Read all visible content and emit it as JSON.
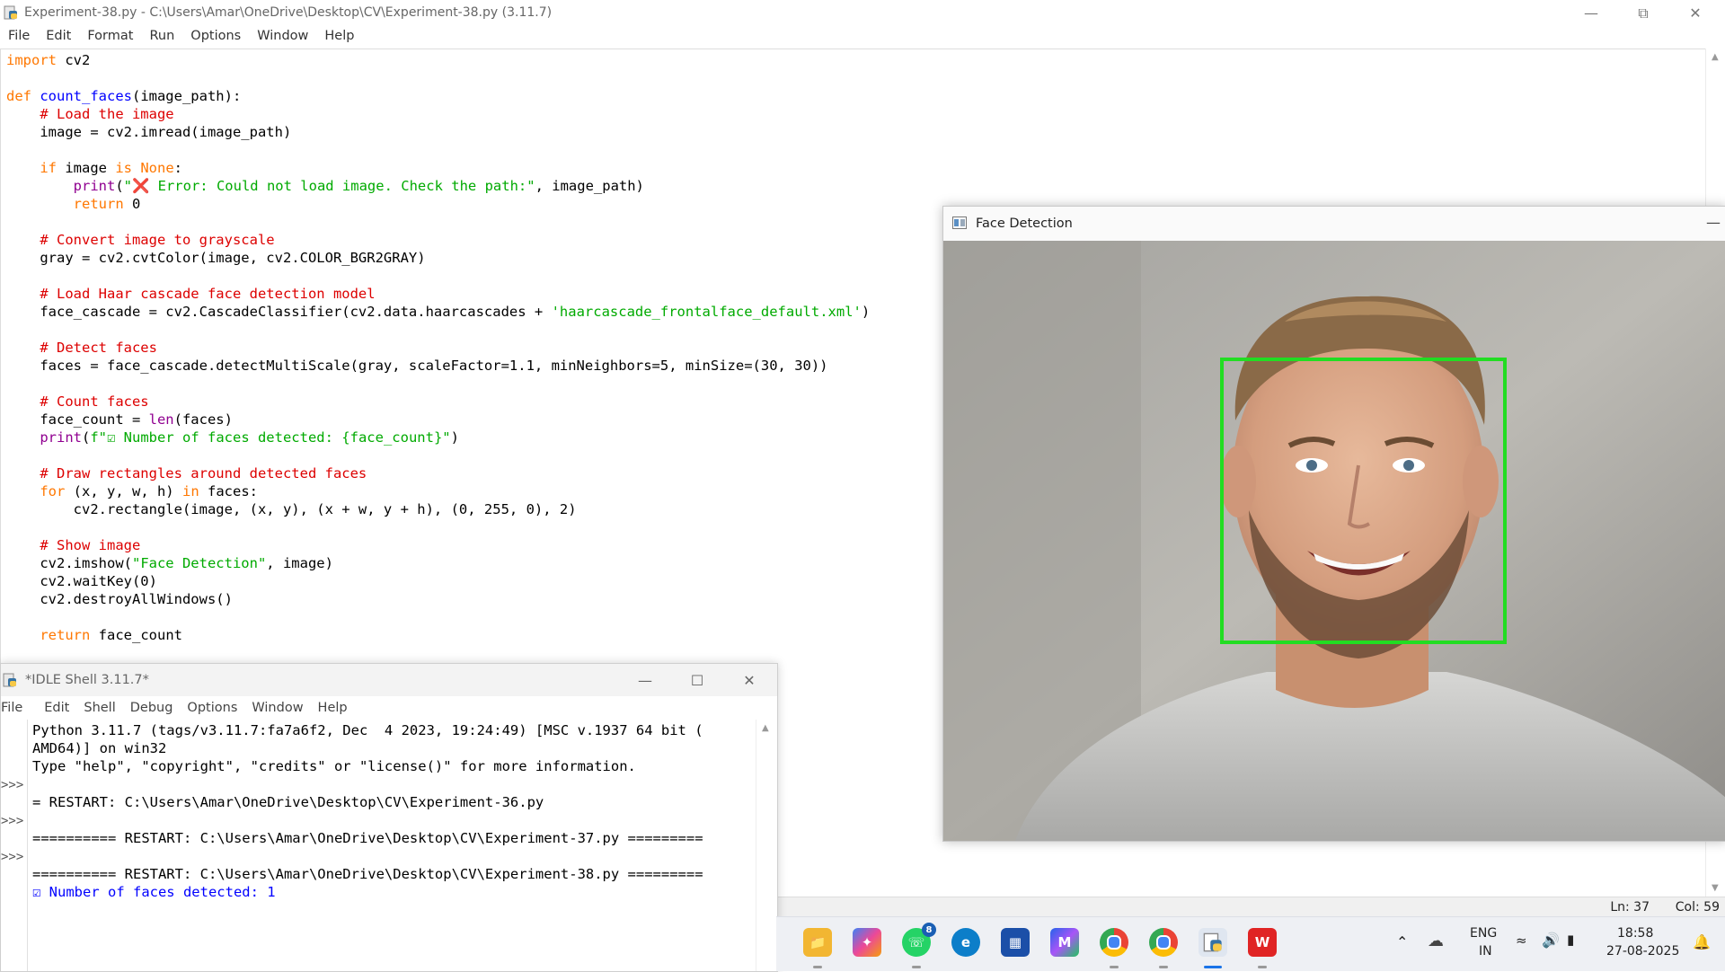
{
  "editor": {
    "title": "Experiment-38.py - C:\\Users\\Amar\\OneDrive\\Desktop\\CV\\Experiment-38.py (3.11.7)",
    "menu": [
      "File",
      "Edit",
      "Format",
      "Run",
      "Options",
      "Window",
      "Help"
    ],
    "status_ln": "Ln: 37",
    "status_col": "Col: 59",
    "code": {
      "l1_kw": "import",
      "l1_rest": " cv2",
      "l3_kw": "def",
      "l3_fn": " count_faces",
      "l3_rest": "(image_path):",
      "l4_cm": "    # Load the image",
      "l5": "    image = cv2.imread(image_path)",
      "l7_kw1": "    if",
      "l7_mid": " image ",
      "l7_kw2": "is",
      "l7_sp": " ",
      "l7_kw3": "None",
      "l7_end": ":",
      "l8_ind": "        ",
      "l8_bi": "print",
      "l8_p": "(",
      "l8_st": "\"❌ Error: Could not load image. Check the path:\"",
      "l8_end": ", image_path)",
      "l9_kw": "        return",
      "l9_rest": " 0",
      "l11_cm": "    # Convert image to grayscale",
      "l12": "    gray = cv2.cvtColor(image, cv2.COLOR_BGR2GRAY)",
      "l14_cm": "    # Load Haar cascade face detection model",
      "l15_a": "    face_cascade = cv2.CascadeClassifier(cv2.data.haarcascades + ",
      "l15_st": "'haarcascade_frontalface_default.xml'",
      "l15_end": ")",
      "l17_cm": "    # Detect faces",
      "l18": "    faces = face_cascade.detectMultiScale(gray, scaleFactor=1.1, minNeighbors=5, minSize=(30, 30))",
      "l20_cm": "    # Count faces",
      "l21_a": "    face_count = ",
      "l21_bi": "len",
      "l21_end": "(faces)",
      "l22_ind": "    ",
      "l22_bi": "print",
      "l22_p": "(",
      "l22_st": "f\"☑ Number of faces detected: {face_count}\"",
      "l22_end": ")",
      "l24_cm": "    # Draw rectangles around detected faces",
      "l25_kw1": "    for",
      "l25_mid": " (x, y, w, h) ",
      "l25_kw2": "in",
      "l25_end": " faces:",
      "l26": "        cv2.rectangle(image, (x, y), (x + w, y + h), (0, 255, 0), 2)",
      "l28_cm": "    # Show image",
      "l29_a": "    cv2.imshow(",
      "l29_st": "\"Face Detection\"",
      "l29_end": ", image)",
      "l30": "    cv2.waitKey(0)",
      "l31": "    cv2.destroyAllWindows()",
      "l33_kw": "    return",
      "l33_rest": " face_count"
    }
  },
  "face_window": {
    "title": "Face Detection",
    "detection_box_color": "#22dd22"
  },
  "shell": {
    "title": "*IDLE Shell 3.11.7*",
    "menu": [
      "File",
      "Edit",
      "Shell",
      "Debug",
      "Options",
      "Window",
      "Help"
    ],
    "prompt": ">>>",
    "lines": {
      "o1": "Python 3.11.7 (tags/v3.11.7:fa7a6f2, Dec  4 2023, 19:24:49) [MSC v.1937 64 bit (",
      "o2": "AMD64)] on win32",
      "o3": "Type \"help\", \"copyright\", \"credits\" or \"license()\" for more information.",
      "o4": "= RESTART: C:\\Users\\Amar\\OneDrive\\Desktop\\CV\\Experiment-36.py",
      "o5": "========== RESTART: C:\\Users\\Amar\\OneDrive\\Desktop\\CV\\Experiment-37.py =========",
      "o6": "========== RESTART: C:\\Users\\Amar\\OneDrive\\Desktop\\CV\\Experiment-38.py =========",
      "o7": "☑ Number of faces detected: 1"
    }
  },
  "taskbar": {
    "apps": [
      "file-explorer",
      "copilot",
      "whatsapp",
      "edge",
      "microsoft-store",
      "m365",
      "chrome",
      "chrome-profile",
      "python-idle",
      "wps-office"
    ],
    "whatsapp_badge": "8",
    "lang": "ENG",
    "region": "IN",
    "time": "18:58",
    "date": "27-08-2025"
  }
}
